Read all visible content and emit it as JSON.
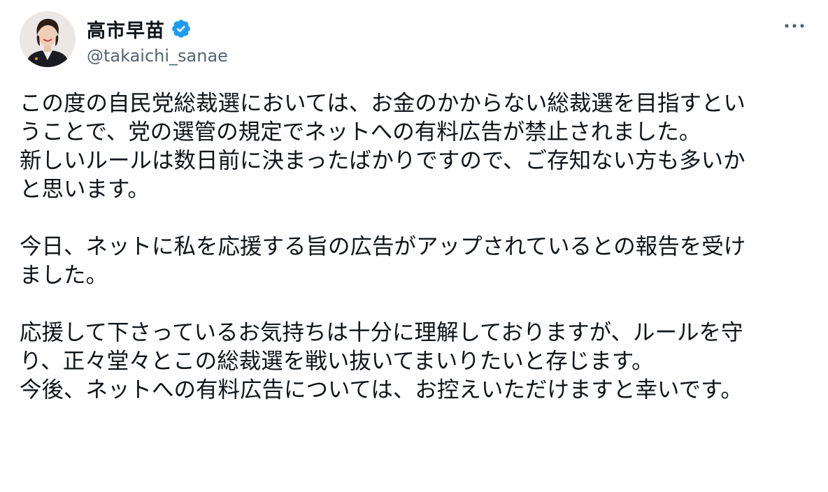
{
  "author": {
    "display_name": "高市早苗",
    "handle": "@takaichi_sanae",
    "verified": true,
    "verified_color": "#1d9bf0"
  },
  "menu": {
    "more_icon": "more-horizontal-icon"
  },
  "post": {
    "lines": [
      "この度の自民党総裁選においては、お金のかからない総裁選を目指すとい",
      "うことで、党の選管の規定でネットへの有料広告が禁止されました。",
      "新しいルールは数日前に決まったばかりですので、ご存知ない方も多いか",
      "と思います。",
      "",
      "今日、ネットに私を応援する旨の広告がアップされているとの報告を受け",
      "ました。",
      "",
      "応援して下さっているお気持ちは十分に理解しておりますが、ルールを守",
      "り、正々堂々とこの総裁選を戦い抜いてまいりたいと存じます。",
      "今後、ネットへの有料広告については、お控えいただけますと幸いです。"
    ]
  },
  "colors": {
    "text": "#0f1419",
    "secondary": "#536471",
    "background": "#ffffff"
  }
}
